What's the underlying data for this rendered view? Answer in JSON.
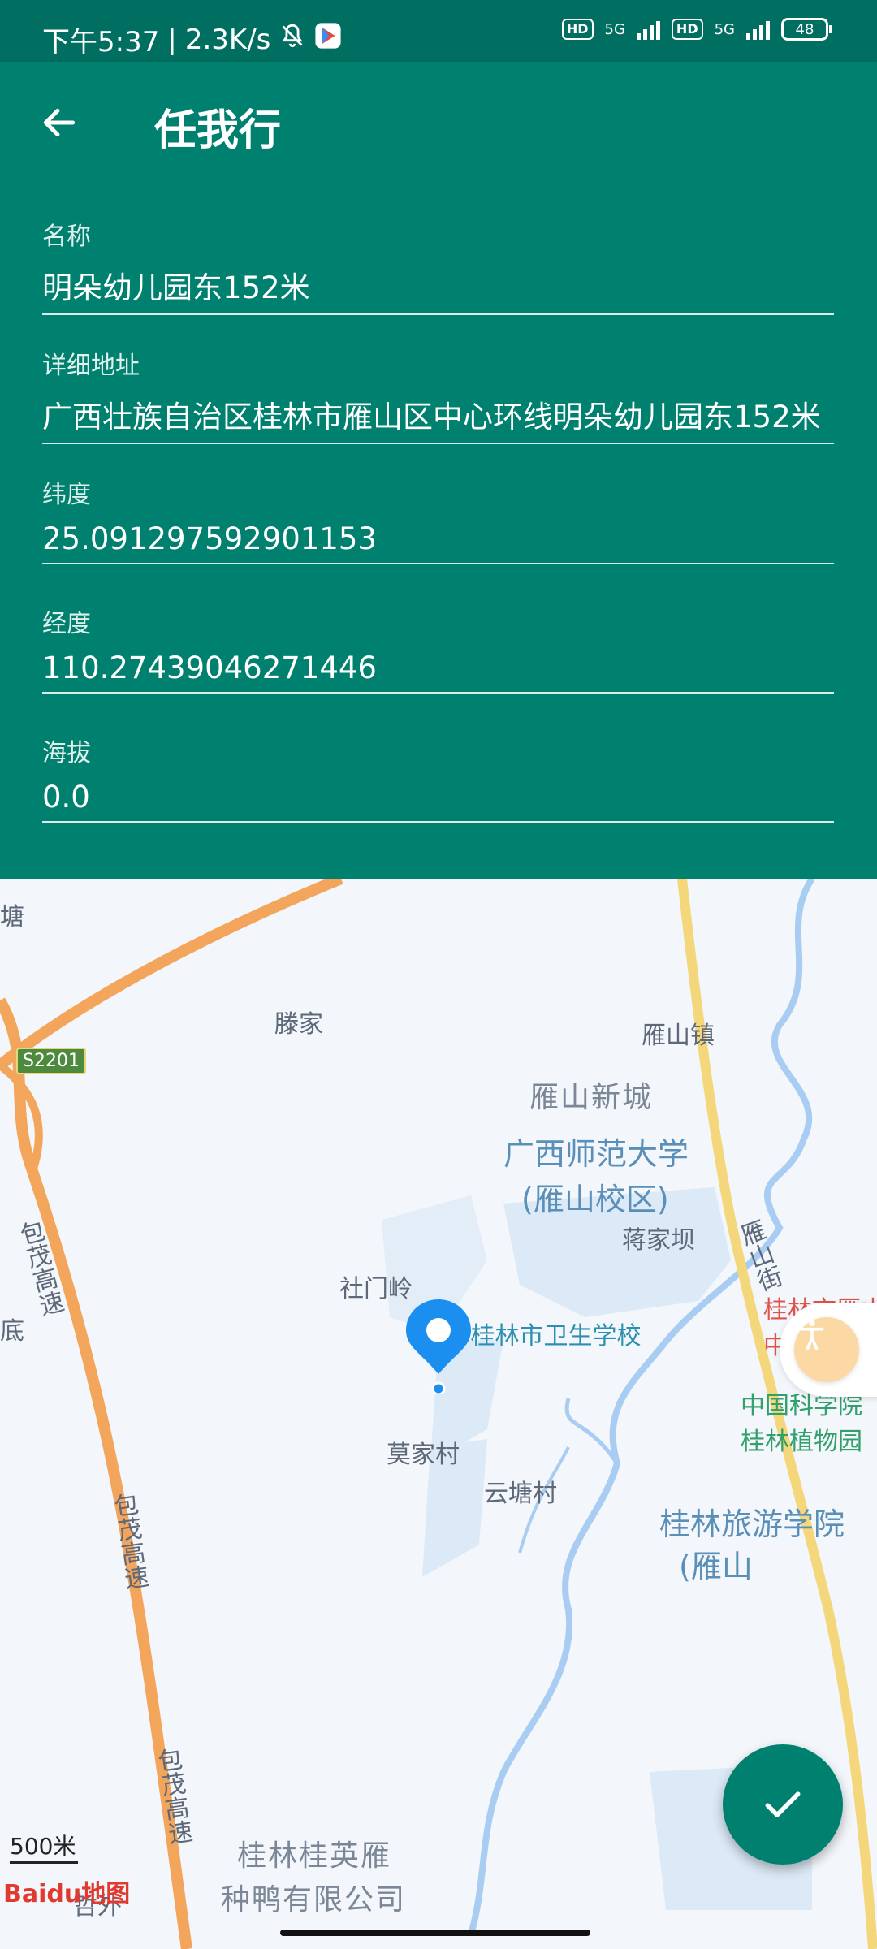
{
  "status": {
    "time": "下午5:37",
    "net_speed": "2.3K/s",
    "hd1": "HD",
    "net1": "5G",
    "hd2": "HD",
    "net2": "5G",
    "battery": "48"
  },
  "app_bar": {
    "title": "任我行"
  },
  "form": {
    "name_label": "名称",
    "name_value": "明朵幼儿园东152米",
    "address_label": "详细地址",
    "address_value": "广西壮族自治区桂林市雁山区中心环线明朵幼儿园东152米",
    "lat_label": "纬度",
    "lat_value": "25.091297592901153",
    "lng_label": "经度",
    "lng_value": "110.27439046271446",
    "alt_label": "海拔",
    "alt_value": "0.0"
  },
  "map": {
    "labels": {
      "tang": "塘",
      "s2201": "S2201",
      "tengjia": "滕家",
      "yanshan_zhen": "雁山镇",
      "yanshan_xincheng": "雁山新城",
      "gxnu_1": "广西师范大学",
      "gxnu_2": "(雁山校区)",
      "baomao_1": "包茂高速",
      "di": "底",
      "jiangjiaba": "蒋家坝",
      "yanshan_street": "雁山街",
      "shemenling": "社门岭",
      "health_school": "桂林市卫生学校",
      "yanshan_hospital_1": "桂林市雁山",
      "yanshan_hospital_2": "中心卫生院",
      "botanical_1": "中国科学院",
      "botanical_2": "桂林植物园",
      "baomao_2": "包茂高速",
      "mojiacun": "莫家村",
      "yuntangcun": "云塘村",
      "guilin_college_1": "桂林旅游学院",
      "guilin_college_2": "(雁山",
      "baomao_3": "包茂高速",
      "duck_1": "桂林桂英雁",
      "duck_2": "种鸭有限公司",
      "wai": "哲外"
    },
    "scale": "500米",
    "logo": "Baidu地图"
  },
  "colors": {
    "primary": "#00806f",
    "status_bar": "#006e60",
    "pin": "#1a8ff0",
    "highway": "#f3a55c"
  }
}
